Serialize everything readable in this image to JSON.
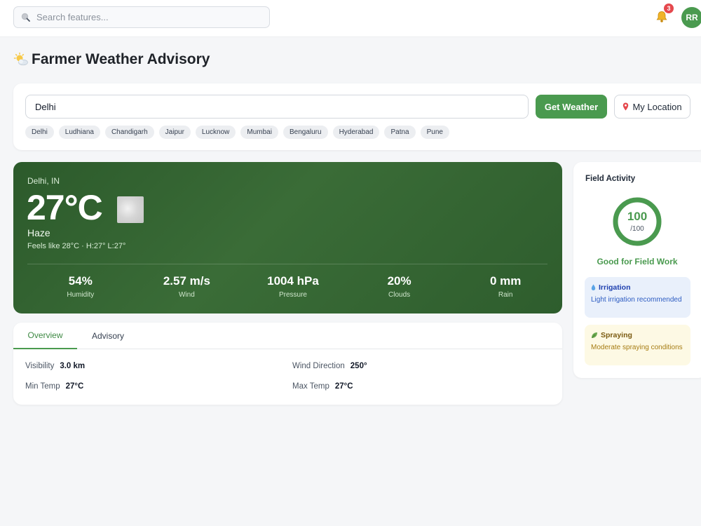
{
  "header": {
    "search_placeholder": "Search features...",
    "notification_count": "3",
    "avatar_initials": "RR"
  },
  "page": {
    "title": "Farmer Weather Advisory"
  },
  "location_form": {
    "city_value": "Delhi",
    "get_weather_label": "Get Weather",
    "my_location_label": "My Location",
    "quick_cities": [
      "Delhi",
      "Ludhiana",
      "Chandigarh",
      "Jaipur",
      "Lucknow",
      "Mumbai",
      "Bengaluru",
      "Hyderabad",
      "Patna",
      "Pune"
    ]
  },
  "weather": {
    "location": "Delhi, IN",
    "temperature": "27°C",
    "condition": "Haze",
    "feels_like": "Feels like 28°C · H:27° L:27°",
    "stats": [
      {
        "value": "54%",
        "label": "Humidity"
      },
      {
        "value": "2.57 m/s",
        "label": "Wind"
      },
      {
        "value": "1004 hPa",
        "label": "Pressure"
      },
      {
        "value": "20%",
        "label": "Clouds"
      },
      {
        "value": "0 mm",
        "label": "Rain"
      }
    ]
  },
  "tabs": {
    "items": [
      "Overview",
      "Advisory"
    ],
    "active": "Overview"
  },
  "overview": {
    "visibility_label": "Visibility",
    "visibility_value": "3.0 km",
    "wind_direction_label": "Wind Direction",
    "wind_direction_value": "250°",
    "min_temp_label": "Min Temp",
    "min_temp_value": "27°C",
    "max_temp_label": "Max Temp",
    "max_temp_value": "27°C"
  },
  "field_activity": {
    "title": "Field Activity",
    "score": "100",
    "score_max": "/100",
    "score_fraction": 1.0,
    "status": "Good for Field Work",
    "status_color": "#4a9a4f",
    "irrigation": {
      "title": "Irrigation",
      "text": "Light irrigation recommended",
      "icon": "water-drop-icon"
    },
    "spraying": {
      "title": "Spraying",
      "text": "Moderate spraying conditions",
      "icon": "leaf-icon"
    }
  },
  "colors": {
    "accent": "#4a9a4f",
    "weather_card": "#2e5d2d",
    "notification_badge": "#e5484d"
  }
}
